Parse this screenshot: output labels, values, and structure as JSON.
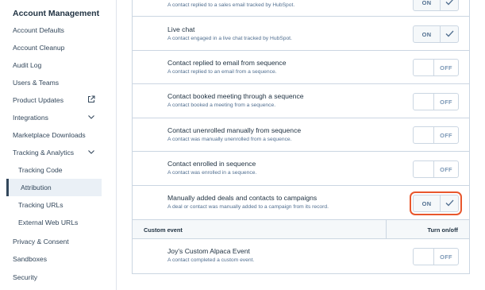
{
  "sidebar": {
    "title": "Account Management",
    "items": [
      {
        "label": "Account Defaults"
      },
      {
        "label": "Account Cleanup"
      },
      {
        "label": "Audit Log"
      },
      {
        "label": "Users & Teams"
      },
      {
        "label": "Product Updates",
        "icon": "external-link-icon"
      },
      {
        "label": "Integrations",
        "icon": "chevron-down-icon"
      },
      {
        "label": "Marketplace Downloads"
      },
      {
        "label": "Tracking & Analytics",
        "icon": "chevron-down-icon"
      },
      {
        "label": "Tracking Code"
      },
      {
        "label": "Attribution"
      },
      {
        "label": "Tracking URLs"
      },
      {
        "label": "External Web URLs"
      },
      {
        "label": "Privacy & Consent"
      },
      {
        "label": "Sandboxes"
      },
      {
        "label": "Security"
      }
    ]
  },
  "rows": [
    {
      "title": "",
      "desc": "A contact replied to a sales email tracked by HubSpot.",
      "state": "ON"
    },
    {
      "title": "Live chat",
      "desc": "A contact engaged in a live chat tracked by HubSpot.",
      "state": "ON"
    },
    {
      "title": "Contact replied to email from sequence",
      "desc": "A contact replied to an email from a sequence.",
      "state": "OFF"
    },
    {
      "title": "Contact booked meeting through a sequence",
      "desc": "A contact booked a meeting from a sequence.",
      "state": "OFF"
    },
    {
      "title": "Contact unenrolled manually from sequence",
      "desc": "A contact was manually unenrolled from a sequence.",
      "state": "OFF"
    },
    {
      "title": "Contact enrolled in sequence",
      "desc": "A contact was enrolled in a sequence.",
      "state": "OFF"
    },
    {
      "title": "Manually added deals and contacts to campaigns",
      "desc": "A deal or contact was manually added to a campaign from its record.",
      "state": "ON"
    }
  ],
  "custom_section": {
    "header_left": "Custom event",
    "header_right": "Turn on/off"
  },
  "custom_rows": [
    {
      "title": "Joy's Custom Alpaca Event",
      "desc": "A contact completed a custom event.",
      "state": "OFF"
    }
  ],
  "colors": {
    "focus_outline": "#e8572d",
    "active_nav_bg": "#eaf0f6"
  }
}
